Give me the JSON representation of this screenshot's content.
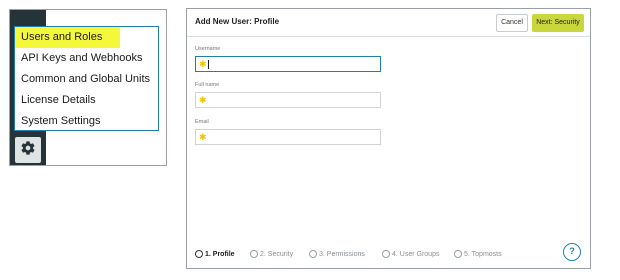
{
  "settings_menu": {
    "items": [
      {
        "label": "Users and Roles",
        "active": true
      },
      {
        "label": "API Keys and Webhooks",
        "active": false
      },
      {
        "label": "Common and Global Units",
        "active": false
      },
      {
        "label": "License Details",
        "active": false
      },
      {
        "label": "System Settings",
        "active": false
      }
    ],
    "icon": "gear-icon",
    "highlight_color": "#f4f73a",
    "border_color": "#1f7fb0",
    "rail_color": "#243438"
  },
  "dialog": {
    "title": "Add New User: Profile",
    "cancel_label": "Cancel",
    "next_label": "Next: Security",
    "next_color": "#c9d63c",
    "fields": [
      {
        "label": "Username",
        "value": "",
        "required": true,
        "focused": true
      },
      {
        "label": "Full name",
        "value": "",
        "required": true,
        "focused": false
      },
      {
        "label": "Email",
        "value": "",
        "required": true,
        "focused": false
      }
    ],
    "required_marker": "✱",
    "steps": [
      {
        "label": "1. Profile",
        "current": true
      },
      {
        "label": "2. Security",
        "current": false
      },
      {
        "label": "3. Permissions",
        "current": false
      },
      {
        "label": "4. User Groups",
        "current": false
      },
      {
        "label": "5. Topmosts",
        "current": false
      }
    ],
    "help_label": "?"
  }
}
